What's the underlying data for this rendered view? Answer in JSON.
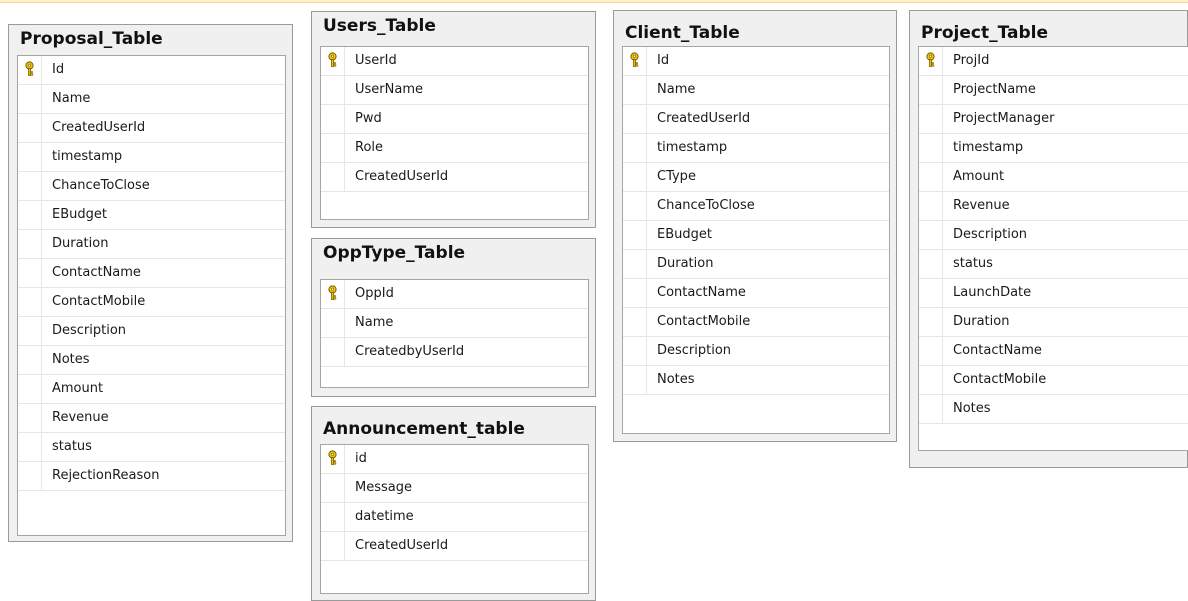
{
  "colors": {
    "card_bg": "#f0f0f0",
    "grid_bg": "#ffffff",
    "key_icon": "#e2b400",
    "border": "#9a9a9a"
  },
  "tables": [
    {
      "title": "Proposal_Table",
      "primary_key": "Id",
      "columns": [
        "Id",
        "Name",
        "CreatedUserId",
        "timestamp",
        "ChanceToClose",
        "EBudget",
        "Duration",
        "ContactName",
        "ContactMobile",
        "Description",
        "Notes",
        "Amount",
        "Revenue",
        "status",
        "RejectionReason"
      ]
    },
    {
      "title": "Users_Table",
      "primary_key": "UserId",
      "columns": [
        "UserId",
        "UserName",
        "Pwd",
        "Role",
        "CreatedUserId"
      ]
    },
    {
      "title": "OppType_Table",
      "primary_key": "OppId",
      "columns": [
        "OppId",
        "Name",
        "CreatedbyUserId"
      ]
    },
    {
      "title": "Announcement_table",
      "primary_key": "id",
      "columns": [
        "id",
        "Message",
        "datetime",
        "CreatedUserId"
      ]
    },
    {
      "title": "Client_Table",
      "primary_key": "Id",
      "columns": [
        "Id",
        "Name",
        "CreatedUserId",
        "timestamp",
        "CType",
        "ChanceToClose",
        "EBudget",
        "Duration",
        "ContactName",
        "ContactMobile",
        "Description",
        "Notes"
      ]
    },
    {
      "title": "Project_Table",
      "primary_key": "ProjId",
      "columns": [
        "ProjId",
        "ProjectName",
        "ProjectManager",
        "timestamp",
        "Amount",
        "Revenue",
        "Description",
        "status",
        "LaunchDate",
        "Duration",
        "ContactName",
        "ContactMobile",
        "Notes"
      ]
    }
  ]
}
